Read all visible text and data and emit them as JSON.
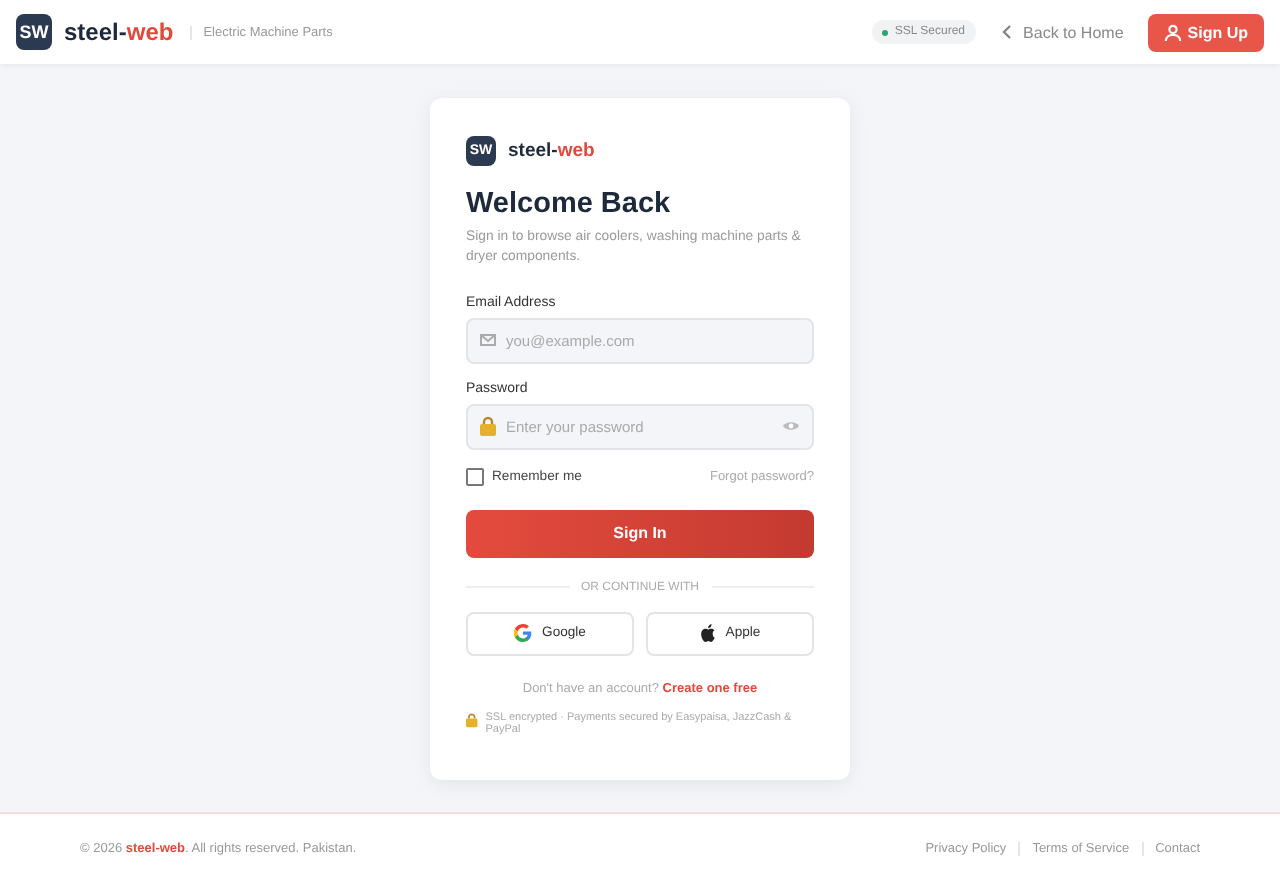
{
  "header": {
    "logo_mark": "SW",
    "brand": "steel-",
    "brand_accent": "web",
    "tagline": "Electric Machine Parts",
    "badge": "SSL Secured",
    "back_link": "Back to Home",
    "signup": "Sign Up"
  },
  "card": {
    "logo_mark": "SW",
    "brand": "steel-",
    "brand_accent": "web",
    "title": "Welcome Back",
    "subtitle": "Sign in to browse air coolers, washing machine parts & dryer components.",
    "fields": [
      {
        "kind": "email",
        "label": "Email Address",
        "placeholder": "you@example.com"
      },
      {
        "kind": "password",
        "label": "Password",
        "placeholder": "Enter your password"
      }
    ],
    "remember": {
      "label": "Remember me",
      "checked": false
    },
    "forgot": "Forgot password?",
    "submit": "Sign In",
    "divider": "OR CONTINUE WITH",
    "social": [
      {
        "kind": "google",
        "label": "Google"
      },
      {
        "kind": "apple",
        "label": "Apple"
      }
    ],
    "signup_prompt": "Don't have an account?",
    "signup_link": "Create one free",
    "security_note": "SSL encrypted · Payments secured by Easypaisa, JazzCash & PayPal"
  },
  "footer": {
    "copyright": "© 2026",
    "brand": "steel-web",
    "rights": ". All rights reserved. Pakistan.",
    "links": [
      "Privacy Policy",
      "Terms of Service",
      "Contact"
    ]
  }
}
